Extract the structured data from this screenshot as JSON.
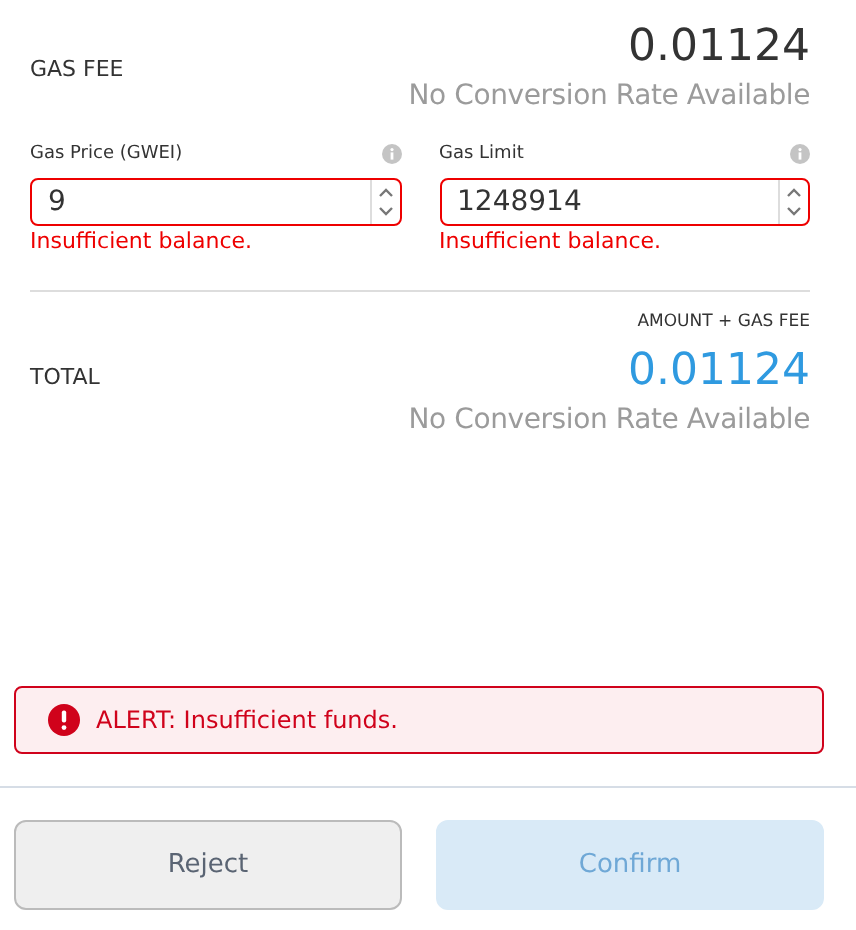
{
  "gas_fee": {
    "label": "GAS FEE",
    "value": "0.01124",
    "conversion": "No Conversion Rate Available"
  },
  "fields": [
    {
      "label": "Gas Price (GWEI)",
      "value": "9",
      "error": "Insufficient balance."
    },
    {
      "label": "Gas Limit",
      "value": "1248914",
      "error": "Insufficient balance."
    }
  ],
  "total": {
    "caption": "AMOUNT + GAS FEE",
    "label": "TOTAL",
    "value": "0.01124",
    "conversion": "No Conversion Rate Available"
  },
  "alert": {
    "text": "ALERT: Insufficient funds."
  },
  "buttons": [
    {
      "label": "Reject",
      "kind": "secondary",
      "disabled": false
    },
    {
      "label": "Confirm",
      "kind": "primary",
      "disabled": true
    }
  ]
}
